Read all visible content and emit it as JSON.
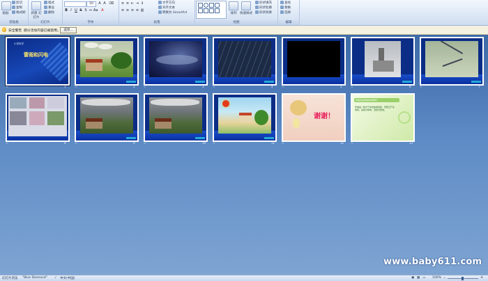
{
  "ribbon": {
    "groups": [
      {
        "label": "剪贴板"
      },
      {
        "label": "幻灯片"
      },
      {
        "label": "字体"
      },
      {
        "label": "段落"
      },
      {
        "label": "绘图"
      },
      {
        "label": "编辑"
      }
    ],
    "clipboard": {
      "items": [
        "剪切",
        "复制",
        "格式刷"
      ],
      "paste_label": "粘贴"
    },
    "slides": {
      "new_label": "新建\n幻灯片",
      "items": [
        "版式",
        "重设",
        "删除"
      ]
    },
    "font": {
      "size": "10"
    },
    "paragraph": {
      "items": [
        "文字方向",
        "对齐文本",
        "转换为 SmartArt"
      ]
    },
    "drawing": {
      "arrange_label": "排列",
      "styles_label": "快速样式",
      "items": [
        "形状填充",
        "形状轮廓",
        "形状效果"
      ]
    },
    "editing": {
      "items": [
        "查找",
        "替换",
        "选择"
      ]
    }
  },
  "security": {
    "title": "安全警告",
    "message": "部分活动内容已被禁用。",
    "options_label": "选项..."
  },
  "slides": [
    {
      "num": "1",
      "title": "雷雨和闪电",
      "subtitle": "小学科学"
    },
    {
      "num": "2"
    },
    {
      "num": "3"
    },
    {
      "num": "4"
    },
    {
      "num": "5"
    },
    {
      "num": "6"
    },
    {
      "num": "7"
    },
    {
      "num": "8"
    },
    {
      "num": "9"
    },
    {
      "num": "10"
    },
    {
      "num": "11"
    },
    {
      "num": "12",
      "text": "谢谢！"
    },
    {
      "num": "13",
      "heading": "你能说出雷电的本质吗？",
      "body": "雷电是一种大气中的放电现象，雷雨云产生电荷，底层为阴电，顶层为阳电。"
    }
  ],
  "status": {
    "view": "幻灯片浏览",
    "theme": "\"Blue Diamond\"",
    "language": "中文(中国)",
    "zoom": "100%"
  },
  "watermark": "www.baby611.com"
}
